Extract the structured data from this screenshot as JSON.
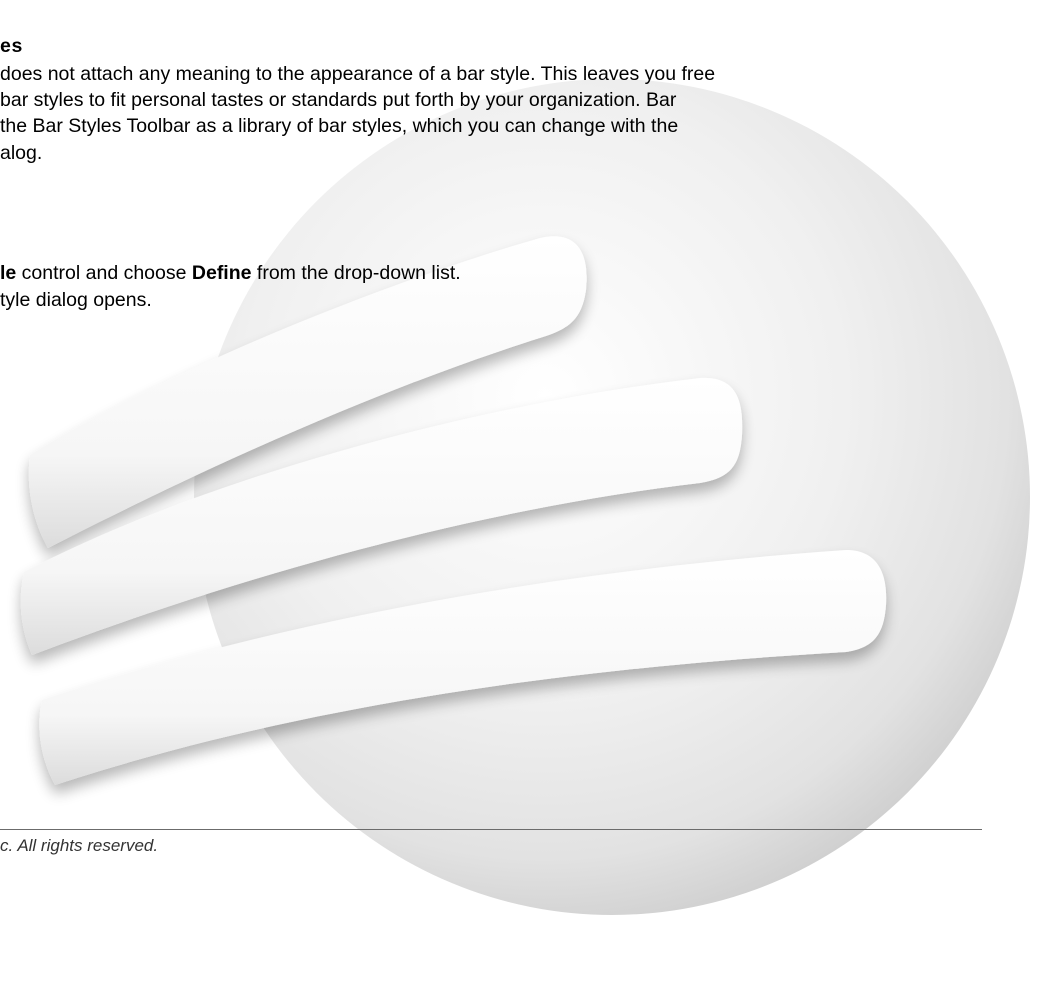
{
  "logo": {
    "name": "sphere-ribbon-logo",
    "colors": {
      "sphere_light": "#ffffff",
      "sphere_mid": "#ececec",
      "sphere_dark": "#c9c9c9",
      "ribbon": "#f7f7f7"
    }
  },
  "section": {
    "heading": "es",
    "paragraph_lines": [
      "does not attach any meaning to the appearance of a bar style. This leaves you free",
      "bar styles to fit personal tastes or standards put forth by your organization. Bar",
      "the Bar Styles Toolbar as a library of bar styles, which you can change with the",
      "alog."
    ]
  },
  "steps": {
    "line1_fragment_a": "le",
    "line1_fragment_b": " control and choose ",
    "line1_fragment_c": "Define",
    "line1_fragment_d": " from the drop-down list.",
    "line2": "tyle dialog opens."
  },
  "footer": {
    "copyright": "c. All rights reserved."
  }
}
